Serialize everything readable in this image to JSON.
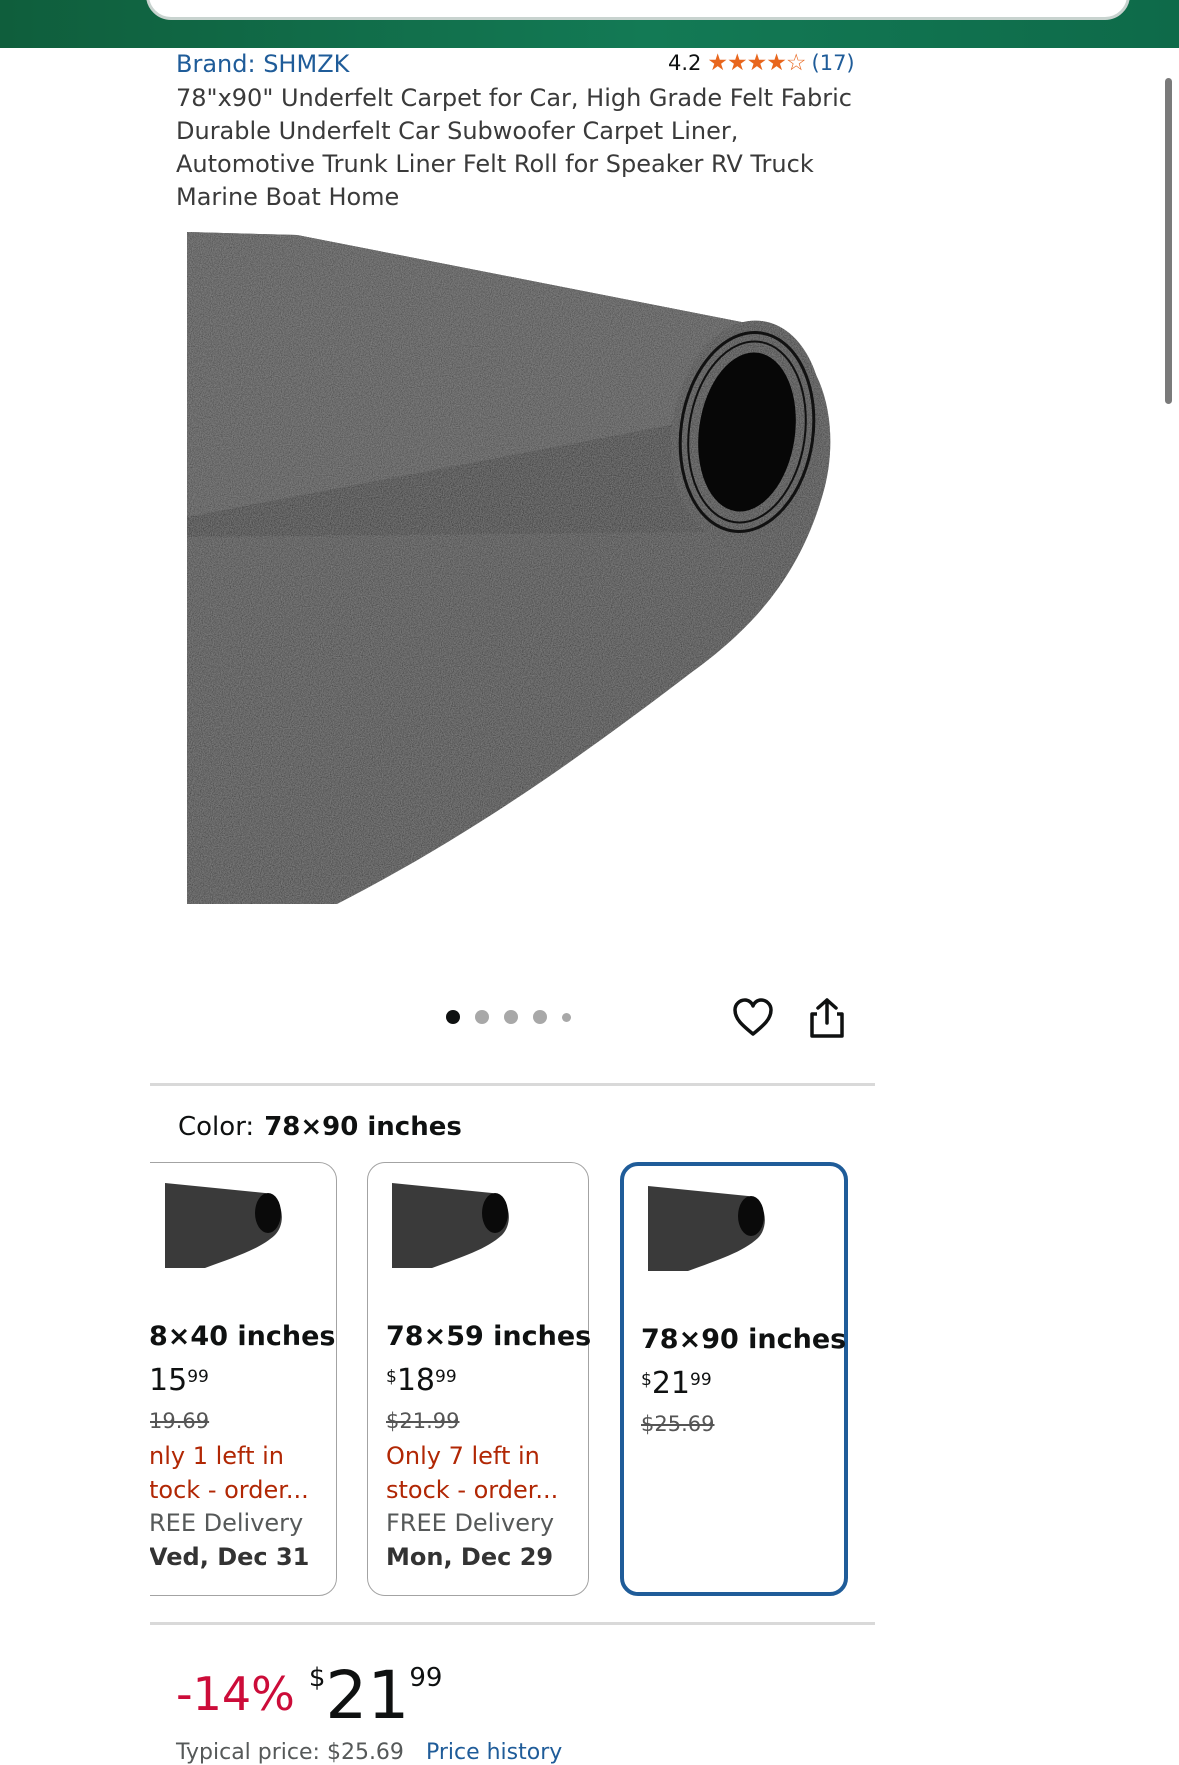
{
  "brand": "Brand: SHMZK",
  "rating": {
    "value": "4.2",
    "stars": "★★★★☆",
    "count": "(17)"
  },
  "title": "78\"x90\" Underfelt Carpet for Car, High Grade Felt Fabric Durable Underfelt Car Subwoofer Carpet Liner, Automotive Trunk Liner Felt Roll for Speaker RV Truck Marine Boat Home",
  "gallery": {
    "image_count": 5,
    "active_index": 0
  },
  "color_selector": {
    "label": "Color:",
    "selected": "78×90 inches"
  },
  "swatches": [
    {
      "name": "8×40 inches",
      "price_whole": "15",
      "price_cents": "99",
      "was": "19.69",
      "stock": "nly 1 left in tock - order...",
      "delivery": "REE Delivery",
      "delivery_date": "Ved, Dec 31"
    },
    {
      "name": "78×59 inches",
      "price_symbol": "$",
      "price_whole": "18",
      "price_cents": "99",
      "was": "$21.99",
      "stock": "Only 7 left in stock - order...",
      "delivery": "FREE Delivery",
      "delivery_date": "Mon, Dec 29"
    },
    {
      "name": "78×90 inches",
      "price_symbol": "$",
      "price_whole": "21",
      "price_cents": "99",
      "was": "$25.69"
    }
  ],
  "price": {
    "discount": "-14%",
    "symbol": "$",
    "whole": "21",
    "cents": "99"
  },
  "typical_price": {
    "label": "Typical price: $25.69",
    "link": "Price history"
  },
  "colors": {
    "brand_green": "#137a55",
    "link_blue": "#1f5c99",
    "deal_red": "#cc0c39",
    "stock_red": "#b12704",
    "star_orange": "#e8661d"
  }
}
